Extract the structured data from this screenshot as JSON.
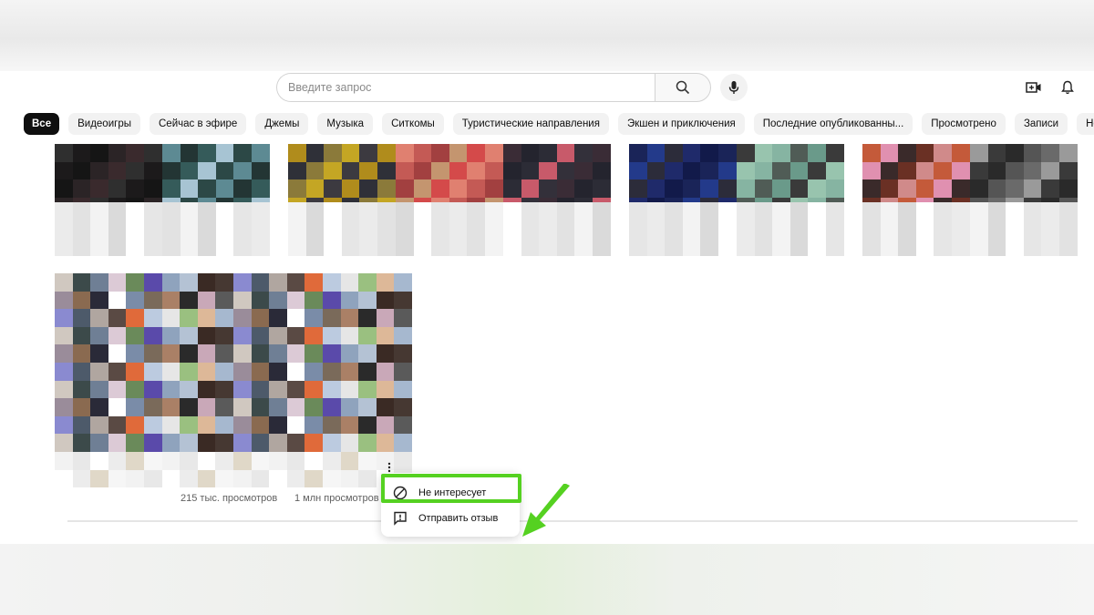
{
  "header": {
    "search_placeholder": "Введите запрос",
    "icons": [
      "search-icon",
      "mic-icon",
      "create-video-icon",
      "bell-icon"
    ]
  },
  "chips": [
    {
      "label": "Все",
      "active": true
    },
    {
      "label": "Видеоигры"
    },
    {
      "label": "Сейчас в эфире"
    },
    {
      "label": "Джемы"
    },
    {
      "label": "Музыка"
    },
    {
      "label": "Ситкомы"
    },
    {
      "label": "Туристические направления"
    },
    {
      "label": "Экшен и приключения"
    },
    {
      "label": "Последние опубликованны..."
    },
    {
      "label": "Просмотрено"
    },
    {
      "label": "Записи"
    },
    {
      "label": "Новое для вас"
    }
  ],
  "videos": {
    "views_2": "215 тыс. просмотров",
    "views_3": "1 млн просмотров"
  },
  "context_menu": {
    "items": [
      {
        "label": "Не интересует",
        "icon": "block-icon"
      },
      {
        "label": "Отправить отзыв",
        "icon": "feedback-icon"
      }
    ]
  },
  "annotation": {
    "highlight_color": "#55d121",
    "arrow_color": "#55d121"
  }
}
